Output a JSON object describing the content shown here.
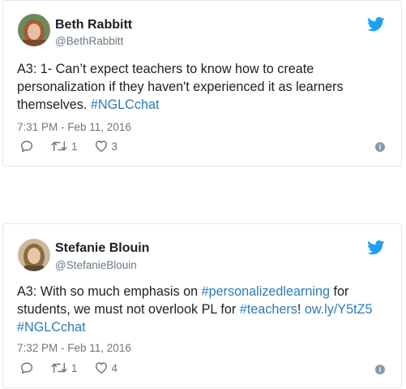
{
  "tweets": [
    {
      "name": "Beth Rabbitt",
      "handle": "@BethRabbitt",
      "text_plain": "A3: 1- Can’t expect teachers to know how to create personalization if they haven't experienced it as learners themselves. ",
      "hashtag": "#NGLCchat",
      "timestamp": "7:31 PM - Feb 11, 2016",
      "retweets": "1",
      "likes": "3",
      "info": "i"
    },
    {
      "name": "Stefanie Blouin",
      "handle": "@StefanieBlouin",
      "text_part1": "A3: With so much emphasis on ",
      "hashtag1": "#personalizedlearning",
      "text_part2": " for students, we must not overlook PL for ",
      "hashtag2": "#teachers",
      "text_part3": "! ",
      "link": "ow.ly/Y5tZ5",
      "hashtag3": "#NGLCchat",
      "timestamp": "7:32 PM - Feb 11, 2016",
      "retweets": "1",
      "likes": "4",
      "info": "i"
    }
  ],
  "colors": {
    "twitter_blue": "#1da1f2",
    "link_blue": "#2b7bb9",
    "muted_gray": "#697882",
    "border": "#e1e8ed"
  },
  "icons": [
    "twitter-bird-icon",
    "reply-icon",
    "retweet-icon",
    "heart-icon",
    "info-icon"
  ]
}
